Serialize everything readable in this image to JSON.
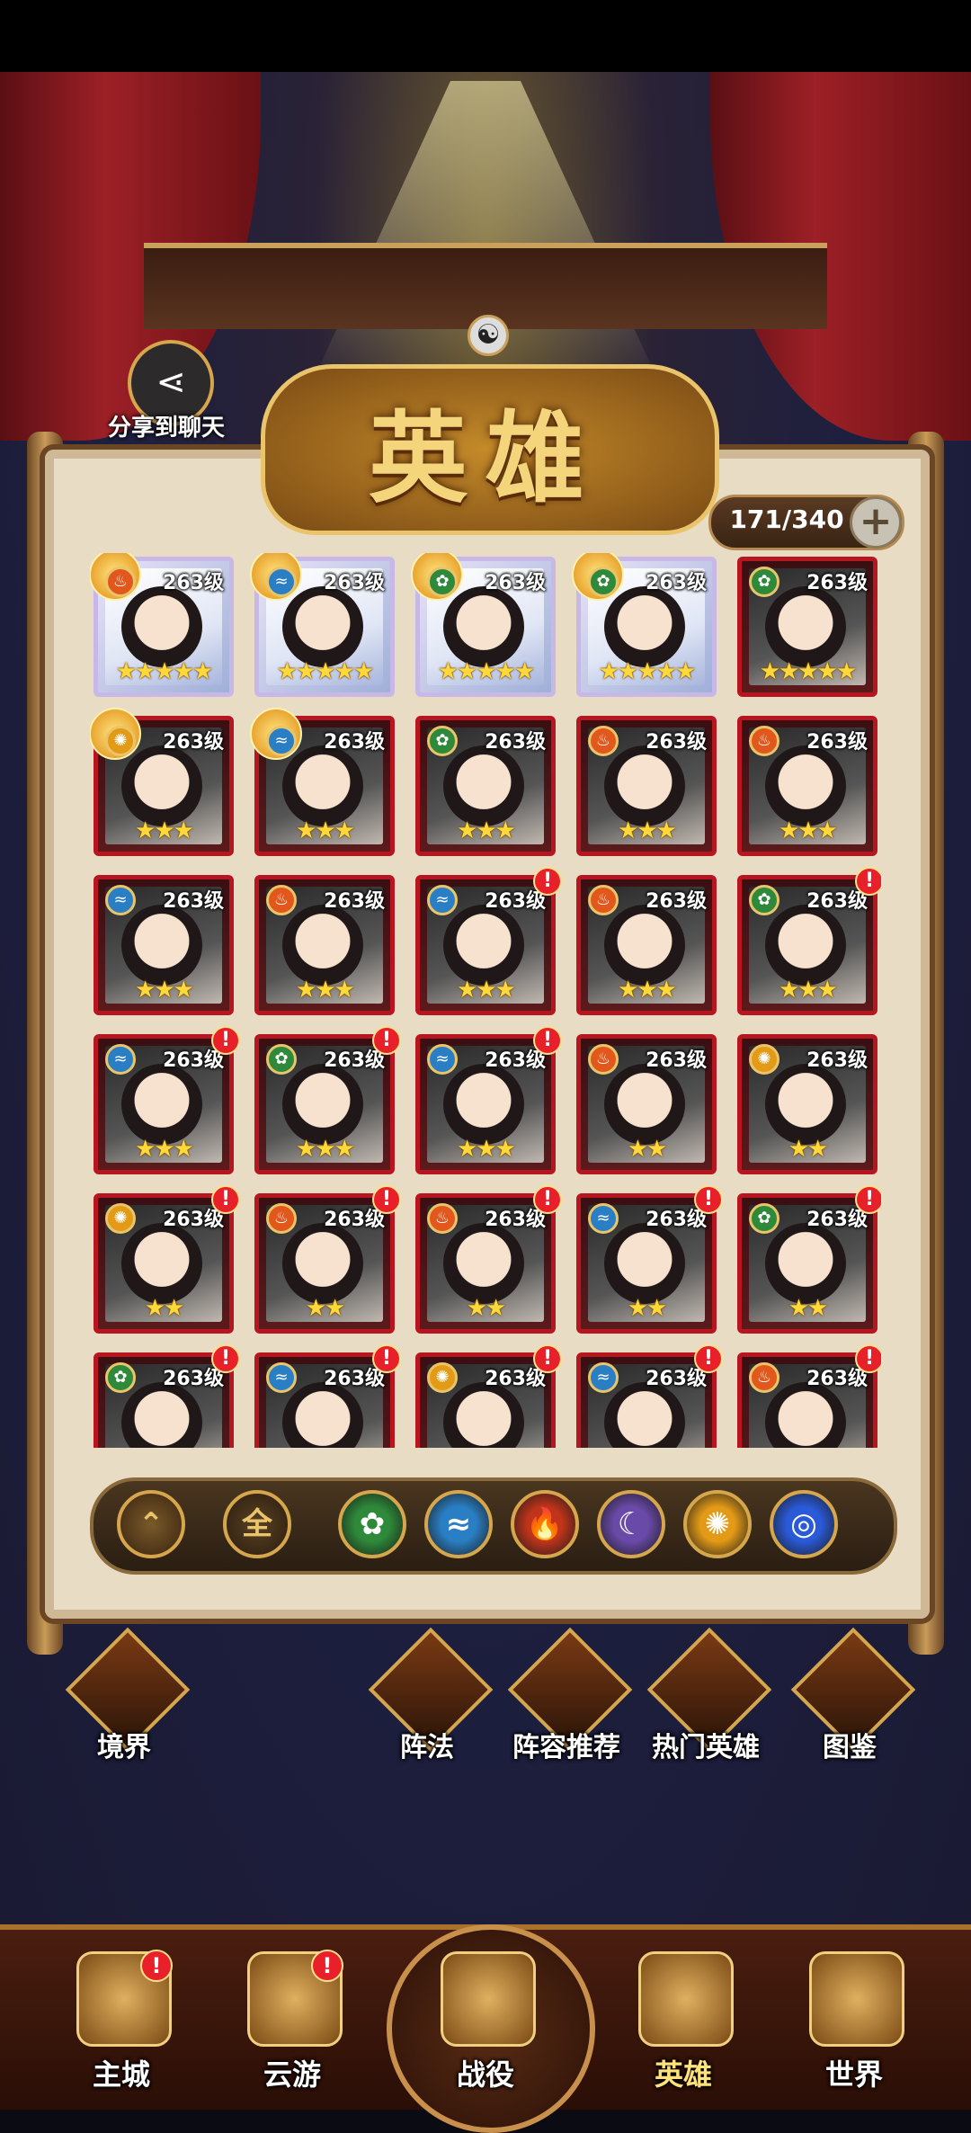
{
  "share": {
    "label": "分享到聊天"
  },
  "header": {
    "title": "英雄",
    "count": "171/340",
    "add_symbol": "+"
  },
  "heroes": [
    {
      "level": "263级",
      "stars": "★★★★★",
      "element": "fire",
      "frame": "gold",
      "alert": false
    },
    {
      "level": "263级",
      "stars": "★★★★★",
      "element": "water",
      "frame": "gold",
      "alert": false
    },
    {
      "level": "263级",
      "stars": "★★★★★",
      "element": "wood",
      "frame": "gold",
      "alert": false
    },
    {
      "level": "263级",
      "stars": "★★★★★",
      "element": "wood",
      "frame": "gold",
      "alert": false
    },
    {
      "level": "263级",
      "stars": "★★★★★",
      "element": "wood",
      "frame": "red",
      "alert": false
    },
    {
      "level": "263级",
      "stars": "★★★",
      "element": "sun",
      "frame": "red",
      "alert": false
    },
    {
      "level": "263级",
      "stars": "★★★",
      "element": "water",
      "frame": "red",
      "alert": false
    },
    {
      "level": "263级",
      "stars": "★★★",
      "element": "wood",
      "frame": "red",
      "alert": false
    },
    {
      "level": "263级",
      "stars": "★★★",
      "element": "fire",
      "frame": "red",
      "alert": false
    },
    {
      "level": "263级",
      "stars": "★★★",
      "element": "fire",
      "frame": "red",
      "alert": false
    },
    {
      "level": "263级",
      "stars": "★★★",
      "element": "water",
      "frame": "red",
      "alert": false
    },
    {
      "level": "263级",
      "stars": "★★★",
      "element": "fire",
      "frame": "red",
      "alert": false
    },
    {
      "level": "263级",
      "stars": "★★★",
      "element": "water",
      "frame": "red",
      "alert": true
    },
    {
      "level": "263级",
      "stars": "★★★",
      "element": "fire",
      "frame": "red",
      "alert": false
    },
    {
      "level": "263级",
      "stars": "★★★",
      "element": "wood",
      "frame": "red",
      "alert": true
    },
    {
      "level": "263级",
      "stars": "★★★",
      "element": "water",
      "frame": "red",
      "alert": true
    },
    {
      "level": "263级",
      "stars": "★★★",
      "element": "wood",
      "frame": "red",
      "alert": true
    },
    {
      "level": "263级",
      "stars": "★★★",
      "element": "water",
      "frame": "red",
      "alert": true
    },
    {
      "level": "263级",
      "stars": "★★",
      "element": "fire",
      "frame": "red",
      "alert": false
    },
    {
      "level": "263级",
      "stars": "★★",
      "element": "sun",
      "frame": "red",
      "alert": false
    },
    {
      "level": "263级",
      "stars": "★★",
      "element": "sun",
      "frame": "red",
      "alert": true
    },
    {
      "level": "263级",
      "stars": "★★",
      "element": "fire",
      "frame": "red",
      "alert": true
    },
    {
      "level": "263级",
      "stars": "★★",
      "element": "fire",
      "frame": "red",
      "alert": true
    },
    {
      "level": "263级",
      "stars": "★★",
      "element": "water",
      "frame": "red",
      "alert": true
    },
    {
      "level": "263级",
      "stars": "★★",
      "element": "wood",
      "frame": "red",
      "alert": true
    },
    {
      "level": "263级",
      "stars": "",
      "element": "wood",
      "frame": "red",
      "alert": true
    },
    {
      "level": "263级",
      "stars": "",
      "element": "water",
      "frame": "red",
      "alert": true
    },
    {
      "level": "263级",
      "stars": "",
      "element": "sun",
      "frame": "red",
      "alert": true
    },
    {
      "level": "263级",
      "stars": "",
      "element": "water",
      "frame": "red",
      "alert": true
    },
    {
      "level": "263级",
      "stars": "",
      "element": "fire",
      "frame": "red",
      "alert": true
    }
  ],
  "element_colors": {
    "fire": "#e2571c",
    "water": "#2a7fc4",
    "wood": "#2e8a3a",
    "sun": "#e39a16",
    "moon": "#6a4aa8",
    "wind": "#2a5ad8"
  },
  "filters": {
    "sort_icon": "⌃",
    "all_label": "全",
    "elements": [
      {
        "name": "wood-filter",
        "glyph": "✿",
        "color": "#2e8a3a"
      },
      {
        "name": "water-filter",
        "glyph": "≈",
        "color": "#2a7fc4"
      },
      {
        "name": "fire-filter",
        "glyph": "🔥",
        "color": "#c0341a"
      },
      {
        "name": "moon-filter",
        "glyph": "☾",
        "color": "#6a4aa8"
      },
      {
        "name": "sun-filter",
        "glyph": "✺",
        "color": "#e39a16"
      },
      {
        "name": "wind-filter",
        "glyph": "◎",
        "color": "#2a5ad8"
      }
    ]
  },
  "functions": [
    {
      "label": "境界"
    },
    {
      "label": "阵法"
    },
    {
      "label": "阵容推荐"
    },
    {
      "label": "热门英雄"
    },
    {
      "label": "图鉴"
    }
  ],
  "nav": [
    {
      "label": "主城",
      "badge": "!"
    },
    {
      "label": "云游",
      "badge": "!"
    },
    {
      "label": "战役",
      "badge": ""
    },
    {
      "label": "英雄",
      "badge": ""
    },
    {
      "label": "世界",
      "badge": ""
    }
  ]
}
